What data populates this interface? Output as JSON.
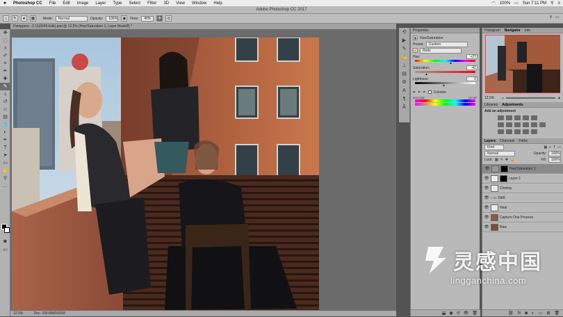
{
  "menubar": {
    "apple": "",
    "app_name": "Photoshop CC",
    "items": [
      "File",
      "Edit",
      "Image",
      "Layer",
      "Type",
      "Select",
      "Filter",
      "3D",
      "View",
      "Window",
      "Help"
    ],
    "battery": "100%",
    "clock": "Sun 7:11 PM"
  },
  "window_title": "Adobe Photoshop CC 2017",
  "options": {
    "mode_label": "Mode:",
    "mode_value": "Normal",
    "opacity_label": "Opacity:",
    "opacity_value": "100%",
    "flow_label": "Flow:",
    "flow_value": "40%"
  },
  "document": {
    "tab_title": "Peteppers - 2.11(6949-Edit).psd @ 12.5% (Hue/Saturation 1, Layer Mask/8) *",
    "zoom": "12.5%",
    "doc_size": "Doc: 339.8M/6416M"
  },
  "properties": {
    "tabs": [
      "Properties"
    ],
    "panel_title": "Hue/Saturation",
    "preset_label": "Preset:",
    "preset_value": "Custom",
    "channel_value": "Reds",
    "hue_label": "Hue:",
    "hue_value": "+27",
    "saturation_label": "Saturation:",
    "saturation_value": "-41",
    "lightness_label": "Lightness:",
    "lightness_value": "0",
    "colorize_label": "Colorize",
    "range_left": "315°/345°",
    "range_right": "15°\\45°"
  },
  "navigator": {
    "tabs": [
      "Histogram",
      "Navigator",
      "Info"
    ],
    "active_tab": "Navigator",
    "zoom": "12.5%"
  },
  "adjustments": {
    "tabs": [
      "Libraries",
      "Adjustments"
    ],
    "add_label": "Add an adjustment"
  },
  "layers": {
    "tabs": [
      "Layers",
      "Channels",
      "Paths"
    ],
    "kind_label": "Kind",
    "blend_mode": "Normal",
    "opacity_label": "Opacity:",
    "opacity_value": "100%",
    "lock_label": "Lock:",
    "fill_label": "Fill:",
    "fill_value": "100%",
    "items": [
      {
        "name": "Hue/Saturation 1"
      },
      {
        "name": "Layer 3"
      },
      {
        "name": "Cloning"
      },
      {
        "name": "D&B"
      },
      {
        "name": "Heal"
      },
      {
        "name": "Capture One Process"
      },
      {
        "name": "Raw"
      }
    ]
  },
  "watermark": {
    "cn_text": "灵感中国",
    "url": "lingganchina.com"
  },
  "colors": {
    "panel_bg": "#b9b9b9",
    "canvas_bg": "#6c6c6c",
    "menubar_bg": "#ececec",
    "selected_layer": "#8a8a8a"
  }
}
